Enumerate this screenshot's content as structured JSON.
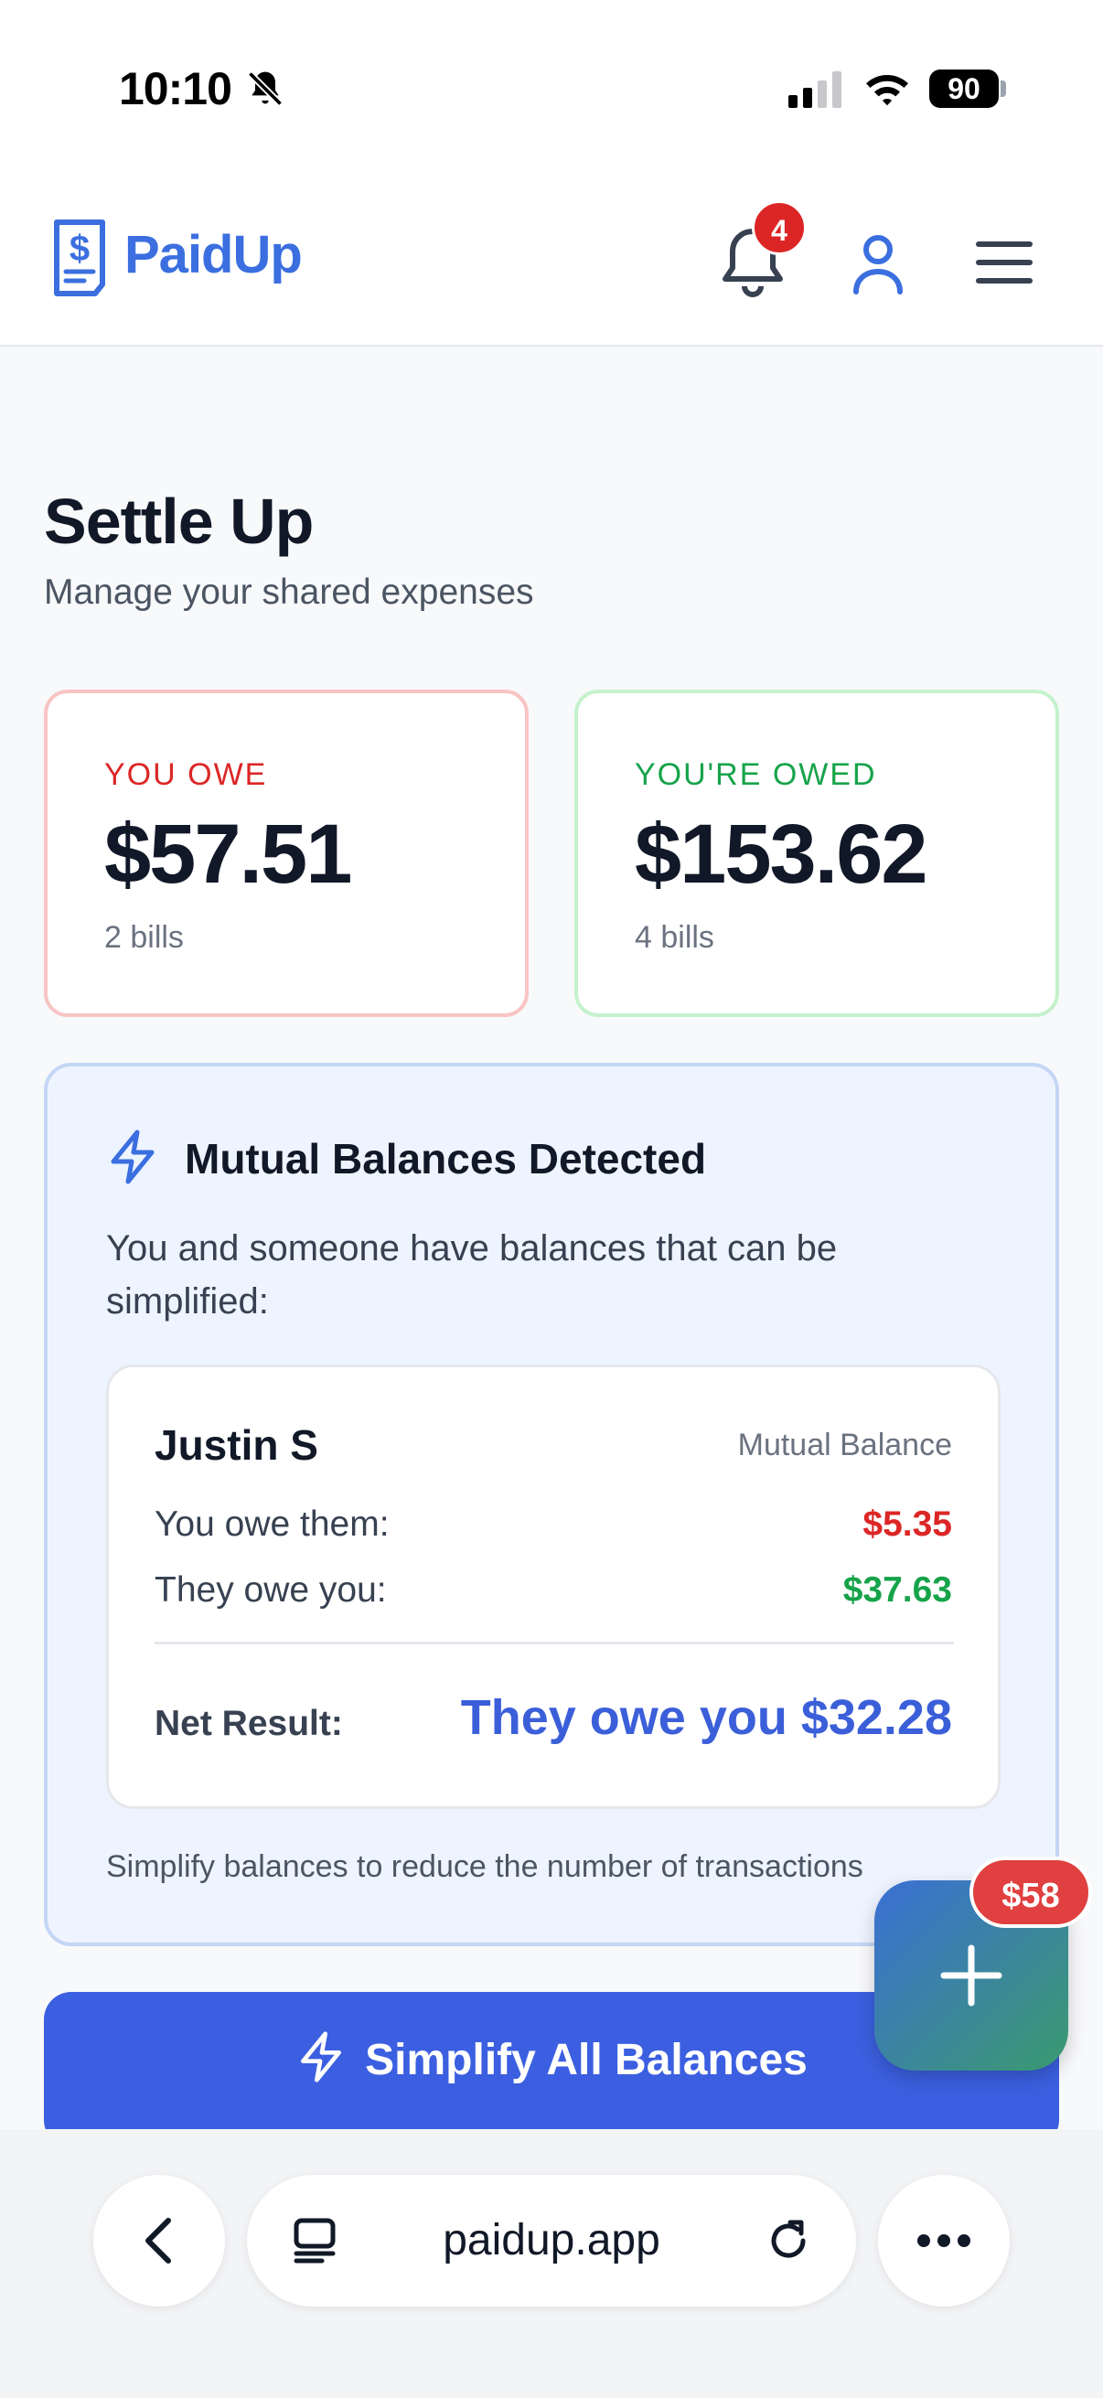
{
  "status_bar": {
    "time": "10:10",
    "battery": "90"
  },
  "header": {
    "brand": "PaidUp",
    "notification_count": "4",
    "icons": [
      "bell-icon",
      "user-icon",
      "hamburger-menu-icon"
    ],
    "brand_color": "#3b6fe0"
  },
  "page": {
    "title": "Settle Up",
    "subtitle": "Manage your shared expenses"
  },
  "summary": {
    "owe": {
      "label": "YOU OWE",
      "amount": "$57.51",
      "bills": "2 bills",
      "color": "#dc2626"
    },
    "owed": {
      "label": "YOU'RE OWED",
      "amount": "$153.62",
      "bills": "4 bills",
      "color": "#16a34a"
    }
  },
  "mutual": {
    "title": "Mutual Balances Detected",
    "description": "You and someone have balances that can be simplified:",
    "card": {
      "name": "Justin S",
      "tag": "Mutual Balance",
      "you_owe_label": "You owe them:",
      "you_owe_value": "$5.35",
      "they_owe_label": "They owe you:",
      "they_owe_value": "$37.63",
      "net_label": "Net Result:",
      "net_value": "They owe you $32.28"
    },
    "note": "Simplify balances to reduce the number of transactions"
  },
  "actions": {
    "simplify_label": "Simplify All Balances",
    "fab_badge": "$58"
  },
  "browser": {
    "url": "paidup.app"
  }
}
